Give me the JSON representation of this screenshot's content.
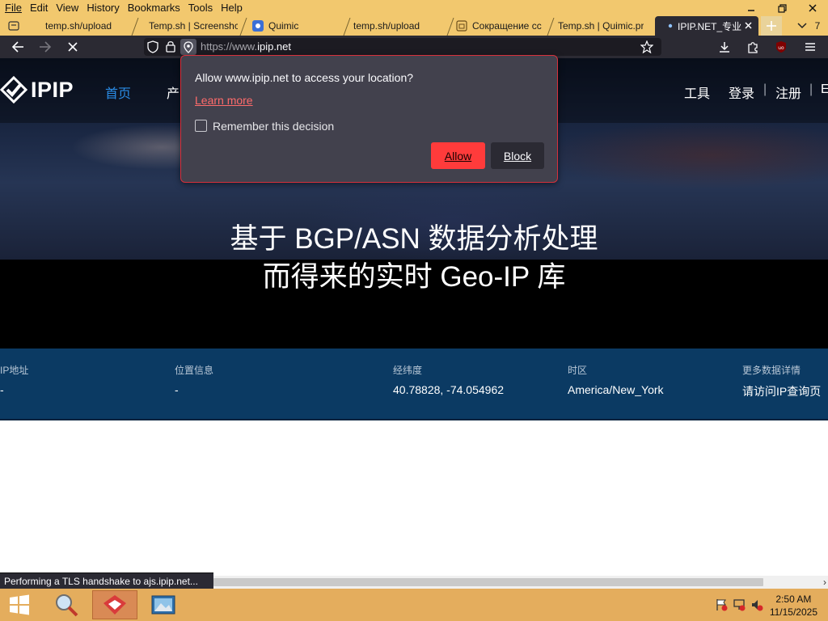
{
  "menubar": {
    "items": [
      "File",
      "Edit",
      "View",
      "History",
      "Bookmarks",
      "Tools",
      "Help"
    ]
  },
  "tabs": [
    {
      "label": "temp.sh/upload",
      "icon": "tab-icon"
    },
    {
      "label": "Temp.sh | Screenshc",
      "icon": "none"
    },
    {
      "label": "Quimic",
      "icon": "quimic-icon"
    },
    {
      "label": "temp.sh/upload",
      "icon": "none"
    },
    {
      "label": "Сокращение сс",
      "icon": "page-icon"
    },
    {
      "label": "Temp.sh | Quimic.pr",
      "icon": "none"
    },
    {
      "label": "IPIP.NET_专业",
      "icon": "dot-icon",
      "active": true
    }
  ],
  "tabbar": {
    "alltabs_count": "7"
  },
  "urlbar": {
    "scheme": "https://www.",
    "host": "ipip.net"
  },
  "site": {
    "logo": "IPIP",
    "nav": [
      "首页",
      "产",
      "",
      "",
      "",
      ""
    ],
    "right_links": [
      "工具",
      "登录",
      "注册",
      "E"
    ],
    "separators": [
      "|",
      "|"
    ],
    "hero_line1": "基于 BGP/ASN 数据分析处理",
    "hero_line2": "而得来的实时 Geo-IP 库"
  },
  "info": {
    "columns": [
      {
        "label": "IP地址",
        "value": "-"
      },
      {
        "label": "位置信息",
        "value": "-"
      },
      {
        "label": "经纬度",
        "value": "40.78828, -74.054962"
      },
      {
        "label": "时区",
        "value": "America/New_York"
      },
      {
        "label": "更多数据详情",
        "value": "请访问IP查询页"
      }
    ]
  },
  "permission": {
    "title": "Allow www.ipip.net to access your location?",
    "learn_more": "Learn more",
    "remember": "Remember this decision",
    "allow": "Allow",
    "block": "Block"
  },
  "status": {
    "text": "Performing a TLS handshake to ajs.ipip.net..."
  },
  "clock": {
    "time": "2:50 AM",
    "date": "11/15/2025"
  },
  "colors": {
    "accent": "#ff3b3b",
    "active_nav": "#2a8ce6",
    "info_band": "#0b3a63",
    "toolbar": "#2b2a33",
    "tabbar": "#f2c86e"
  }
}
